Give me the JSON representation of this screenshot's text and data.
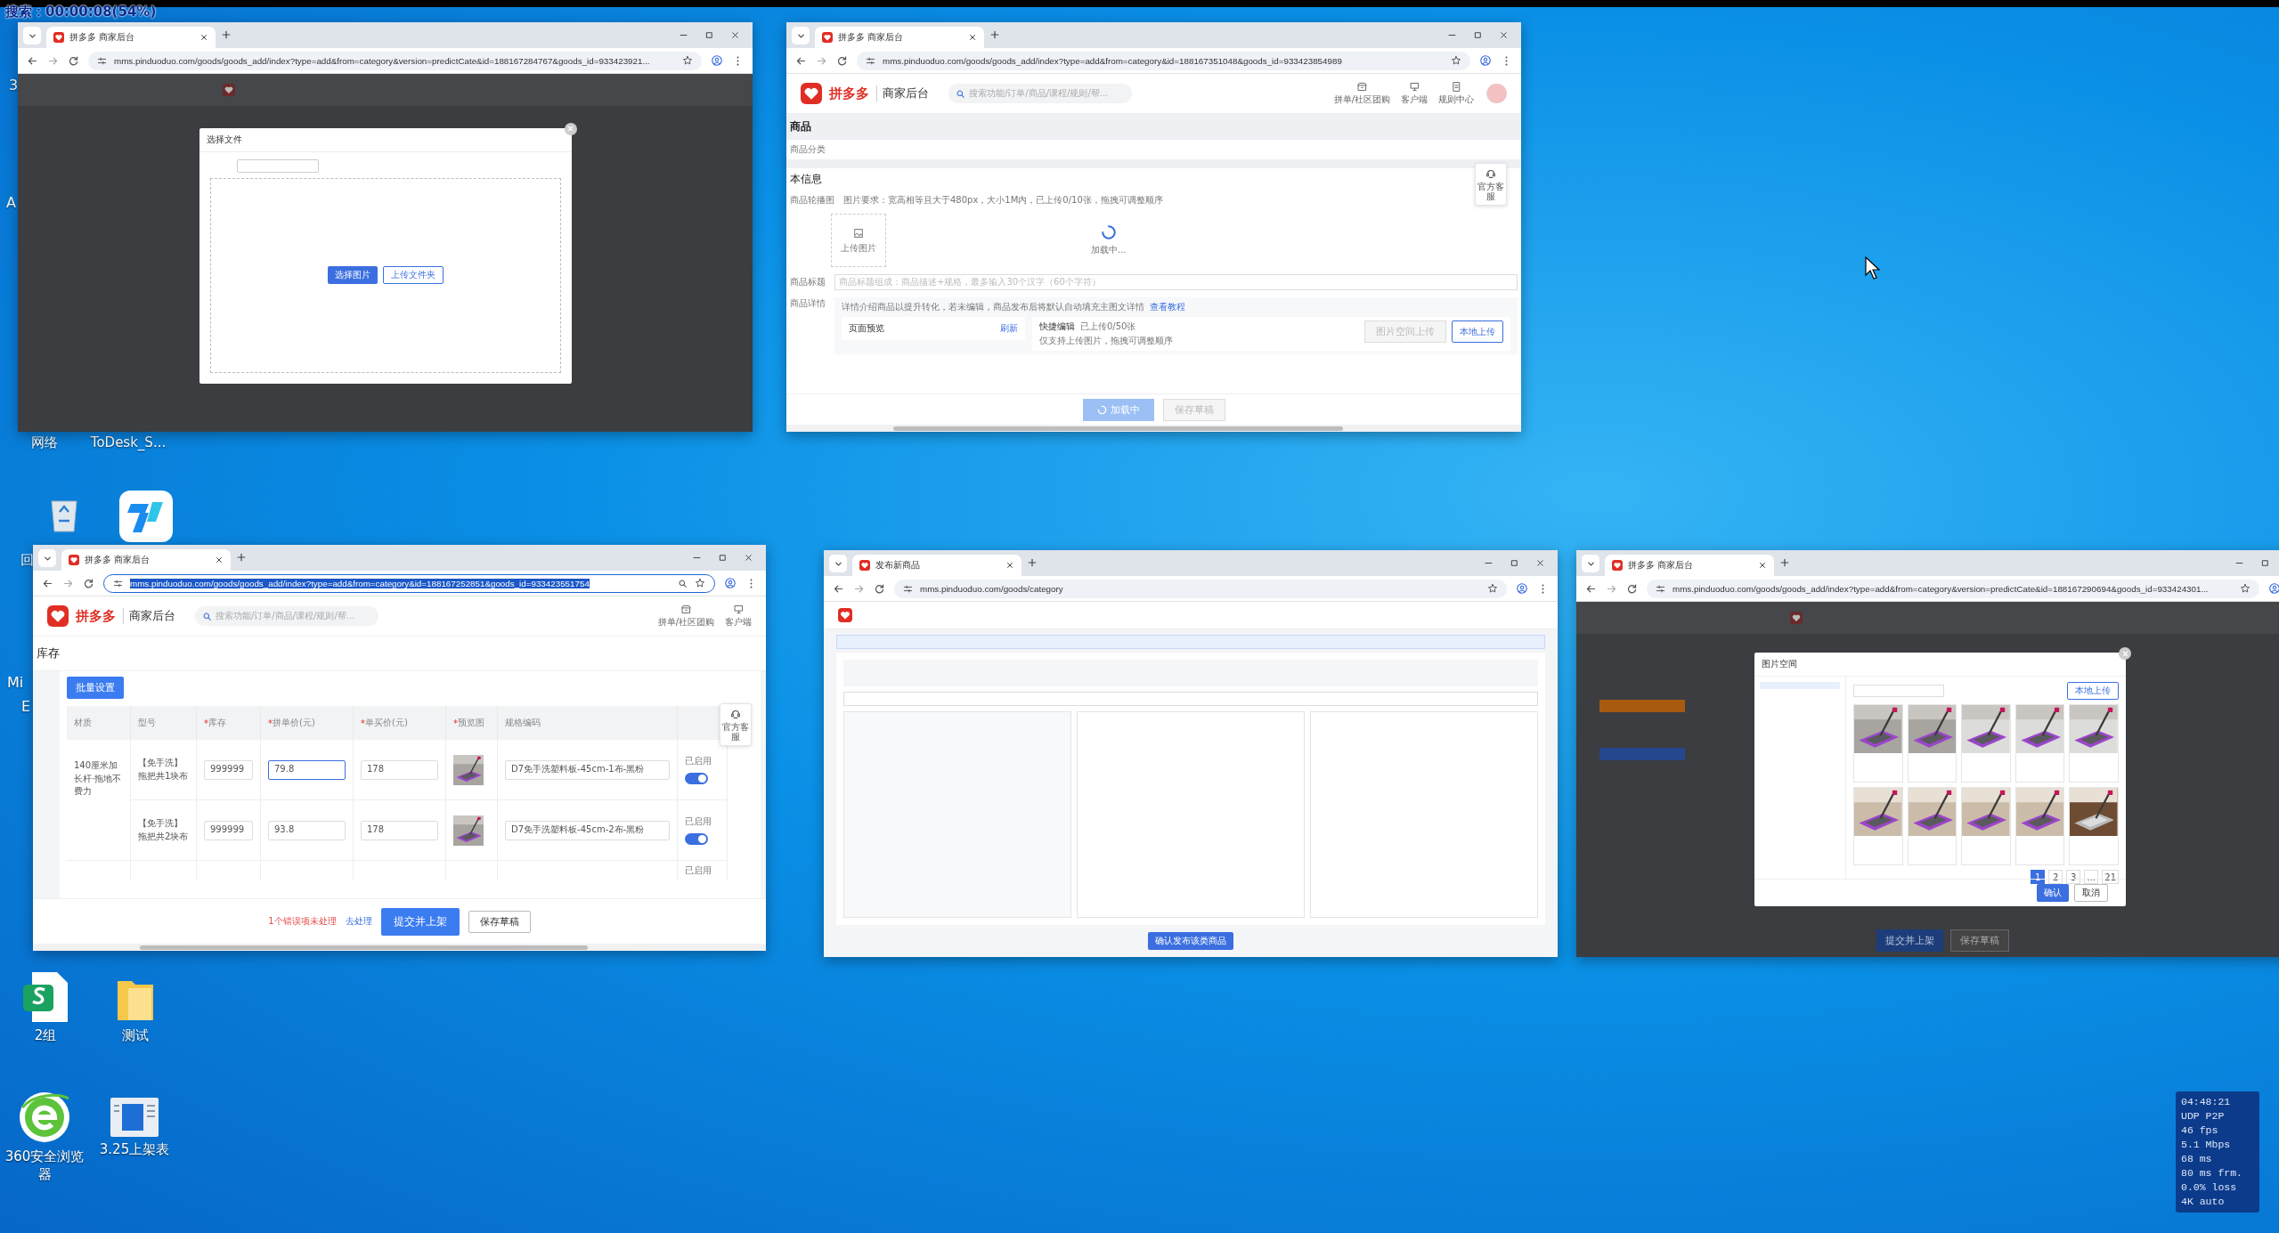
{
  "recording_label": "搜索：00:00:08(54%)",
  "desktop_fragments": [
    "3",
    "A",
    "Mi",
    "E"
  ],
  "desktop_icons": [
    {
      "kind": "hidden",
      "label": "网络"
    },
    {
      "kind": "hidden",
      "label": "ToDesk_S..."
    },
    {
      "kind": "recycle-bin",
      "label": "回"
    },
    {
      "kind": "todesk"
    },
    {
      "kind": "spreadsheet",
      "label": "2组"
    },
    {
      "kind": "folder",
      "label": "测试"
    },
    {
      "kind": "browser",
      "label": "360安全浏览器"
    },
    {
      "kind": "document",
      "label": "3.25上架表"
    }
  ],
  "windows": [
    {
      "kind": "upload-dialog",
      "tab_title": "拼多多 商家后台",
      "url": "mms.pinduoduo.com/goods/goods_add/index?type=add&from=category&version=predictCate&id=188167284767&goods_id=933423921...",
      "url_selected": false,
      "dialog": {
        "title": "选择文件",
        "buttons": [
          "选择图片",
          "上传文件夹"
        ]
      }
    },
    {
      "kind": "loading-form",
      "tab_title": "拼多多 商家后台",
      "url": "mms.pinduoduo.com/goods/goods_add/index?type=add&from=category&id=188167351048&goods_id=933423854989",
      "url_selected": false,
      "header": {
        "brand": "拼多多",
        "subtitle": "商家后台",
        "search_placeholder": "搜索功能/订单/商品/课程/规则/帮...",
        "tools": [
          "拼单/社区团购",
          "客户端",
          "规则中心"
        ]
      },
      "page_title": "商品",
      "category_label": "商品分类",
      "section_title": "本信息",
      "carousel_label": "商品轮播图",
      "carousel_hint": "图片要求：宽高相等且大于480px，大小1M内，已上传0/10张，拖拽可调整顺序",
      "upload_label": "上传图片",
      "loading_text": "加载中...",
      "title_label": "商品标题",
      "title_placeholder": "商品标题组成：商品描述+规格，最多输入30个汉字（60个字符）",
      "detail_label": "商品详情",
      "detail_hint": "详情介绍商品以提升转化，若未编辑，商品发布后将默认自动填充主图文详情",
      "detail_link": "查看教程",
      "preview_label": "页面预览",
      "refresh_label": "刷新",
      "quick_edit_label": "快捷编辑",
      "quick_edit_count": "已上传0/50张",
      "quick_edit_hint": "仅支持上传图片，拖拽可调整顺序",
      "upload_buttons": [
        "图片空间上传",
        "本地上传"
      ],
      "footer_buttons": [
        {
          "kind": "loading",
          "label": "加载中"
        },
        {
          "kind": "disabled",
          "label": "保存草稿"
        }
      ],
      "service_label": "官方客服"
    },
    {
      "kind": "sku-table",
      "tab_title": "拼多多 商家后台",
      "url": "mms.pinduoduo.com/goods/goods_add/index?type=add&from=category&id=188167252851&goods_id=933423551754",
      "url_selected": true,
      "header": {
        "brand": "拼多多",
        "subtitle": "商家后台",
        "search_placeholder": "搜索功能/订单/商品/课程/规则/帮...",
        "tools": [
          "拼单/社区团购",
          "客户端"
        ]
      },
      "section_title": "库存",
      "batch_button": "批量设置",
      "columns": [
        {
          "label": "材质"
        },
        {
          "label": "型号"
        },
        {
          "label": "库存",
          "required_mark": "*"
        },
        {
          "label": "拼单价(元)",
          "required_mark": "*"
        },
        {
          "label": "单买价(元)",
          "required_mark": "*"
        },
        {
          "label": "预览图",
          "required_mark": "*"
        },
        {
          "label": "规格编码"
        }
      ],
      "rows": [
        {
          "kind": "full",
          "material": "140厘米加长杆·拖地不费力",
          "model": "【免手洗】拖把共1块布",
          "stock": "999999",
          "group_price": "79.8",
          "single_price": "178",
          "code": "D7免手洗塑料板-45cm-1布-黑粉",
          "status": "已启用",
          "enabled": true,
          "focused": true
        },
        {
          "kind": "full",
          "model": "【免手洗】拖把共2块布",
          "stock": "999999",
          "group_price": "93.8",
          "single_price": "178",
          "code": "D7免手洗塑料板-45cm-2布-黑粉",
          "status": "已启用",
          "enabled": true,
          "focused": false
        },
        {
          "kind": "partial",
          "status": "已启用"
        }
      ],
      "service_label": "官方客服",
      "footer": {
        "error": "1个错误项未处理",
        "fix_link": "去处理",
        "submit": "提交并上架",
        "draft": "保存草稿"
      }
    },
    {
      "kind": "category",
      "tab_title": "发布新商品",
      "url": "mms.pinduoduo.com/goods/category",
      "url_selected": false,
      "confirm_button": "确认发布该类商品"
    },
    {
      "kind": "image-picker",
      "tab_title": "拼多多 商家后台",
      "url": "mms.pinduoduo.com/goods/goods_add/index?type=add&from=category&version=predictCate&id=188167290694&goods_id=933424301...",
      "url_selected": false,
      "dialog": {
        "title": "图片空间",
        "upload_button": "本地上传",
        "pages": [
          {
            "label": "1",
            "selected": true
          },
          {
            "label": "2",
            "selected": false
          },
          {
            "label": "3",
            "selected": false
          },
          {
            "label": "...",
            "selected": false
          },
          {
            "label": "21",
            "selected": false
          }
        ],
        "confirm": "确认",
        "cancel": "取消"
      },
      "page_buttons": [
        "提交并上架",
        "保存草稿"
      ]
    }
  ],
  "stats": [
    "04:48:21",
    "UDP P2P",
    "46 fps",
    "5.1 Mbps",
    "68 ms",
    "80 ms frm.",
    "0.0% loss",
    "4K auto"
  ]
}
